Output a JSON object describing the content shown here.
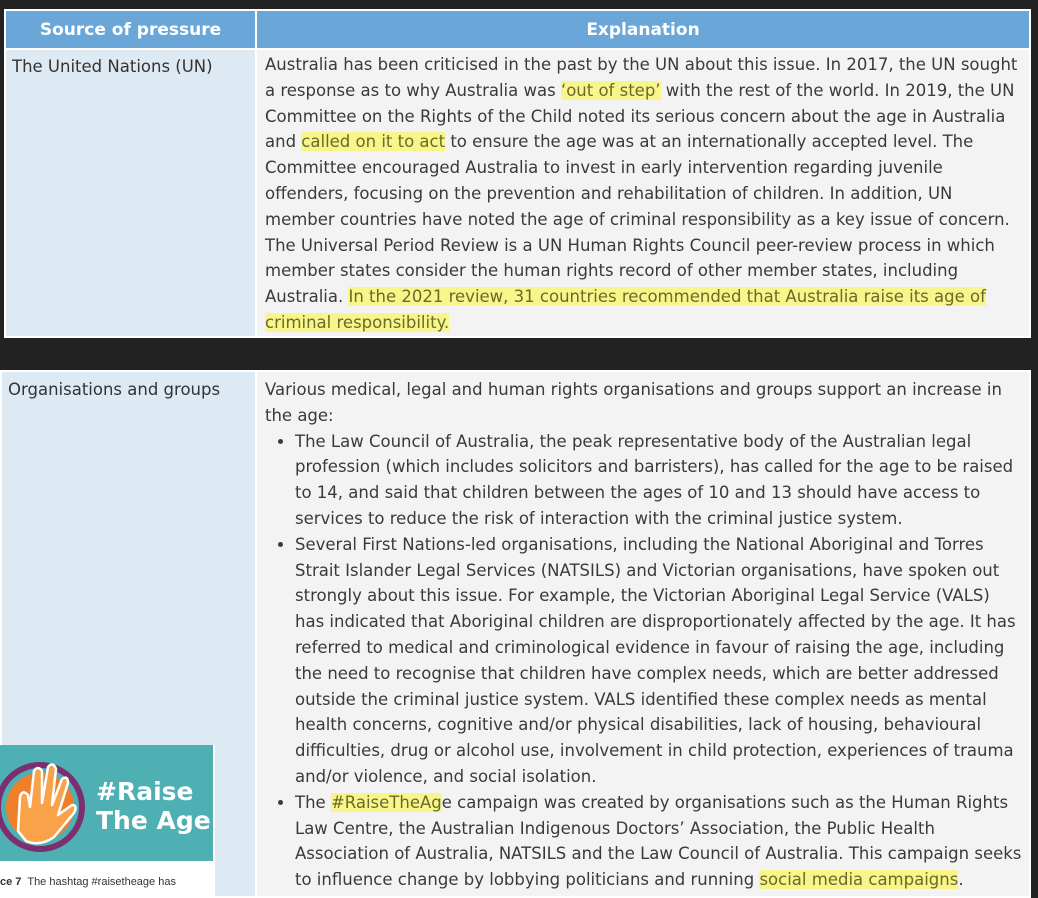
{
  "table1": {
    "headers": [
      "Source of pressure",
      "Explanation"
    ],
    "row": {
      "source": "The United Nations (UN)",
      "explanation": [
        {
          "text": "Australia has been criticised in the past by the UN about this issue. In 2017, the UN sought a response as to why Australia was "
        },
        {
          "text": "‘out of step’",
          "highlight": true
        },
        {
          "text": " with the rest of the world. In 2019, the UN Committee on the Rights of the Child noted its serious concern about the age in Australia and "
        },
        {
          "text": "called on it to act",
          "highlight": true
        },
        {
          "text": " to ensure the age was at an internationally accepted level. The Committee encouraged Australia to invest in early intervention regarding juvenile offenders, focusing on the prevention and rehabilitation of children. In addition, UN member countries have noted the age of criminal responsibility as a key issue of concern. The Universal Period Review is a UN Human Rights Council peer-review process in which member states consider the human rights record of other member states, including Australia. "
        },
        {
          "text": "In the 2021 review, 31 countries recommended that Australia raise its age of criminal responsibility.",
          "highlight": true
        }
      ]
    }
  },
  "table2": {
    "row": {
      "source": "Organisations and groups",
      "intro": "Various medical, legal and human rights organisations and groups support an increase in the age:",
      "bullets": [
        [
          {
            "text": "The Law Council of Australia, the peak representative body of the Australian legal profession (which includes solicitors and barristers), has called for the age to be raised to 14, and said that children between the ages of 10 and 13 should have access to services to reduce the risk of interaction with the criminal justice system."
          }
        ],
        [
          {
            "text": "Several First Nations-led organisations, including the National Aboriginal and Torres Strait Islander Legal Services (NATSILS) and Victorian organisations, have spoken out strongly about this issue. For example, the Victorian Aboriginal Legal Service (VALS) has indicated that Aboriginal children are disproportionately affected by the age. It has referred to medical and criminological evidence in favour of raising the age, including the need to recognise that children have complex needs, which are better addressed outside the criminal justice system. VALS identified these complex needs as mental health concerns, cognitive and/or physical disabilities, lack of housing, behavioural difficulties, drug or alcohol use, involvement in child protection, experiences of trauma and/or violence, and social isolation."
          }
        ],
        [
          {
            "text": "The "
          },
          {
            "text": "#RaiseTheAg",
            "highlight": true
          },
          {
            "text": "e campaign was created by organisations such as the Human Rights Law Centre, the Australian Indigenous Doctors’ Association, the Public Health Association of Australia, NATSILS and the Law Council of Australia. This campaign seeks to influence change by lobbying politicians and running "
          },
          {
            "text": "social media campaigns",
            "highlight": true
          },
          {
            "text": "."
          }
        ]
      ]
    }
  },
  "image": {
    "hashtag_line1": "#Raise",
    "hashtag_line2": "The Age",
    "caption_prefix": "ce 7",
    "caption_text": "The hashtag #raisetheage has",
    "bg_color": "#4fb0b3"
  }
}
